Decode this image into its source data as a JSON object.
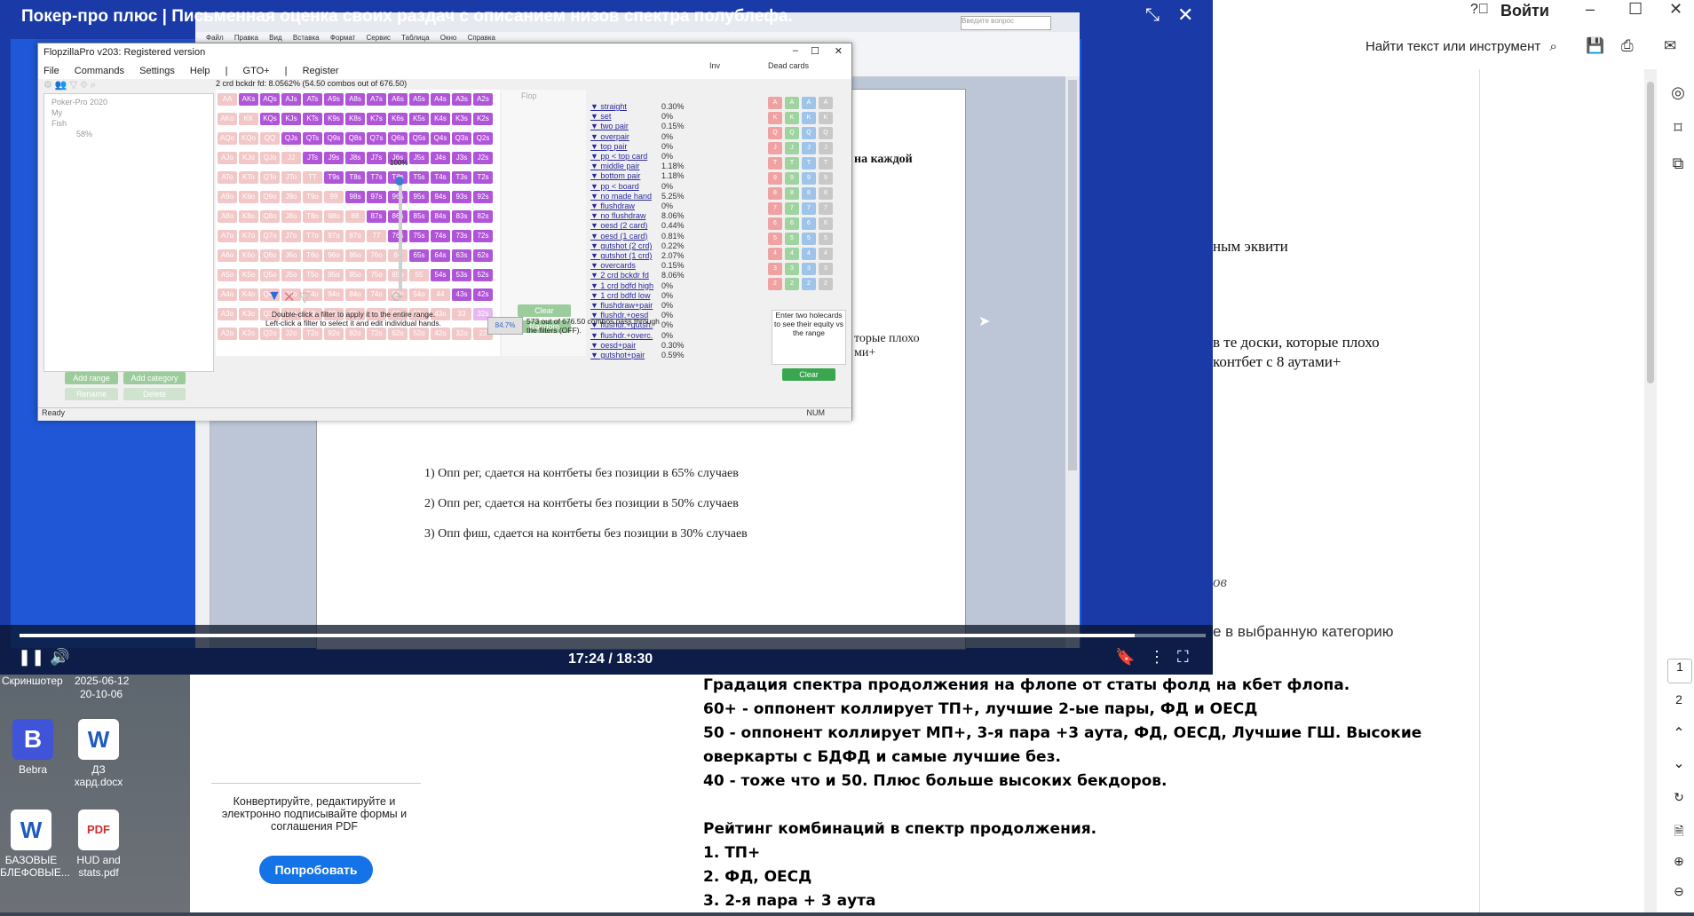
{
  "player": {
    "title": "Покер-про плюс | Письменная оценка своих раздач с описанием низов спектра полублефа.",
    "time": "17:24 / 18:30",
    "progress": 0.94
  },
  "word": {
    "ribbon_hint": "Введите вопрос",
    "menu": [
      "Файл",
      "Правка",
      "Вид",
      "Вставка",
      "Формат",
      "Сервис",
      "Таблица",
      "Окно",
      "Справка"
    ],
    "page_text_partial_1": "на каждой",
    "page_text_partial_2": "торые плохо",
    "page_text_partial_3": "ми+",
    "list": [
      "1)  Опп рег, сдается на контбеты без позиции в 65% случаев",
      "2)  Опп рег, сдается на контбеты без позиции в 50% случаев",
      "3)  Опп фиш, сдается на контбеты без позиции в 30% случаев"
    ]
  },
  "flopzilla": {
    "title": "FlopzillaPro v203: Registered version",
    "menu": [
      "File",
      "Commands",
      "Settings",
      "Help",
      "|",
      "GTO+",
      "|",
      "Register"
    ],
    "header": "2 crd bckdr fd: 8.0562%   (54.50 combos out of 676.50)",
    "tree": [
      "Poker-Pro 2020",
      "My",
      "Fish",
      "58%"
    ],
    "buttons": [
      "Add range",
      "Add category",
      "Rename",
      "Delete"
    ],
    "slider_pct": "100%",
    "filter_hint_1": "Double-click a filter to apply it to the entire range.",
    "filter_hint_2": "Left-click a filter to select it and edit individual hands.",
    "flop_label": "Flop",
    "inv_label": "Inv",
    "dead_cards": "Dead cards",
    "stats": [
      {
        "name": "straight",
        "pct": "0.30%"
      },
      {
        "name": "set",
        "pct": "0%"
      },
      {
        "name": "two pair",
        "pct": "0.15%"
      },
      {
        "name": "overpair",
        "pct": "0%"
      },
      {
        "name": "top pair",
        "pct": "0%"
      },
      {
        "name": "pp < top card",
        "pct": "0%"
      },
      {
        "name": "middle pair",
        "pct": "1.18%"
      },
      {
        "name": "bottom pair",
        "pct": "1.18%"
      },
      {
        "name": "pp < board",
        "pct": "0%"
      },
      {
        "name": "no made hand",
        "pct": "5.25%"
      },
      {
        "name": "flushdraw",
        "pct": "0%"
      },
      {
        "name": "no flushdraw",
        "pct": "8.06%"
      },
      {
        "name": "oesd (2 card)",
        "pct": "0.44%"
      },
      {
        "name": "oesd (1 card)",
        "pct": "0.81%"
      },
      {
        "name": "gutshot (2 crd)",
        "pct": "0.22%"
      },
      {
        "name": "gutshot (1 crd)",
        "pct": "2.07%"
      },
      {
        "name": "overcards",
        "pct": "0.15%"
      },
      {
        "name": "2 crd bckdr fd",
        "pct": "8.06%"
      },
      {
        "name": "1 crd bdfd high",
        "pct": "0%"
      },
      {
        "name": "1 crd bdfd low",
        "pct": "0%"
      },
      {
        "name": "flushdraw+pair",
        "pct": "0%"
      },
      {
        "name": "flushdr.+oesd",
        "pct": "0%"
      },
      {
        "name": "flushdr.+gutsh.",
        "pct": "0%"
      },
      {
        "name": "flushdr.+overc.",
        "pct": "0%"
      },
      {
        "name": "oesd+pair",
        "pct": "0.30%"
      },
      {
        "name": "gutshot+pair",
        "pct": "0.59%"
      }
    ],
    "mid_buttons": [
      "Clear",
      "Random"
    ],
    "filter_result": "573 out of 676.50 combos pass through the filters (OFF).",
    "filter_pct": "84.7%",
    "equity_hint": "Enter two holecards to see their equity vs the range",
    "clear": "Clear",
    "status_left": "Ready",
    "status_right": "NUM",
    "grid_rows": [
      [
        "AA",
        "AKs",
        "AQs",
        "AJs",
        "ATs",
        "A9s",
        "A8s",
        "A7s",
        "A6s",
        "A5s",
        "A4s",
        "A3s",
        "A2s"
      ],
      [
        "AKo",
        "KK",
        "KQs",
        "KJs",
        "KTs",
        "K9s",
        "K8s",
        "K7s",
        "K6s",
        "K5s",
        "K4s",
        "K3s",
        "K2s"
      ],
      [
        "AQo",
        "KQo",
        "QQ",
        "QJs",
        "QTs",
        "Q9s",
        "Q8s",
        "Q7s",
        "Q6s",
        "Q5s",
        "Q4s",
        "Q3s",
        "Q2s"
      ],
      [
        "AJo",
        "KJo",
        "QJo",
        "JJ",
        "JTs",
        "J9s",
        "J8s",
        "J7s",
        "J6s",
        "J5s",
        "J4s",
        "J3s",
        "J2s"
      ],
      [
        "ATo",
        "KTo",
        "QTo",
        "JTo",
        "TT",
        "T9s",
        "T8s",
        "T7s",
        "T6s",
        "T5s",
        "T4s",
        "T3s",
        "T2s"
      ],
      [
        "A9o",
        "K9o",
        "Q9o",
        "J9o",
        "T9o",
        "99",
        "98s",
        "97s",
        "96s",
        "95s",
        "94s",
        "93s",
        "92s"
      ],
      [
        "A8o",
        "K8o",
        "Q8o",
        "J8o",
        "T8o",
        "98o",
        "88",
        "87s",
        "86s",
        "85s",
        "84s",
        "83s",
        "82s"
      ],
      [
        "A7o",
        "K7o",
        "Q7o",
        "J7o",
        "T7o",
        "97o",
        "87o",
        "77",
        "76s",
        "75s",
        "74s",
        "73s",
        "72s"
      ],
      [
        "A6o",
        "K6o",
        "Q6o",
        "J6o",
        "T6o",
        "96o",
        "86o",
        "76o",
        "66",
        "65s",
        "64s",
        "63s",
        "62s"
      ],
      [
        "A5o",
        "K5o",
        "Q5o",
        "J5o",
        "T5o",
        "95o",
        "85o",
        "75o",
        "65o",
        "55",
        "54s",
        "53s",
        "52s"
      ],
      [
        "A4o",
        "K4o",
        "Q4o",
        "J4o",
        "T4o",
        "94o",
        "84o",
        "74o",
        "64o",
        "54o",
        "44",
        "43s",
        "42s"
      ],
      [
        "A3o",
        "K3o",
        "Q3o",
        "J3o",
        "T3o",
        "93o",
        "83o",
        "73o",
        "63o",
        "53o",
        "43o",
        "33",
        "32s"
      ],
      [
        "A2o",
        "K2o",
        "Q2o",
        "J2o",
        "T2o",
        "92o",
        "82o",
        "72o",
        "62o",
        "52o",
        "42o",
        "32o",
        "22"
      ]
    ]
  },
  "acrobat": {
    "login": "Войти",
    "search": "Найти текст или инструмент",
    "partial_1": "ным эквити",
    "partial_2": "в те доски, которые плохо",
    "partial_3": "контбет с 8 аутами+",
    "partial_4": "ов",
    "partial_5": "е в выбранную категорию",
    "lines": [
      {
        "text": "Градация спектра продолжения на флопе от статы фолд на кбет флопа.",
        "color": "#2b2b2b"
      },
      {
        "text": "60+ - оппонент коллирует ТП+, лучшие 2-ые пары, ФД и ОЕСД",
        "color": "#2fa84f"
      },
      {
        "text": "50 - оппонент коллирует МП+, 3-я пара +3 аута, ФД, ОЕСД, Лучшие ГШ. Высокие",
        "color": "#5b2db3"
      },
      {
        "text": "оверкарты с БДФД и самые лучшие без.",
        "color": "#5b2db3"
      },
      {
        "text": "40 - тоже что и 50. Плюс больше высоких бекдоров.",
        "color": "#d4294a"
      },
      {
        "text": "",
        "color": "#000"
      },
      {
        "text": "Рейтинг комбинаций в спектр продолжения.",
        "color": "#2b2b2b"
      },
      {
        "text": "1. ТП+",
        "color": "#2fa84f"
      },
      {
        "text": "2. ФД, ОЕСД",
        "color": "#2fa84f"
      },
      {
        "text": "3. 2-я пара + 3 аута",
        "color": "#2fa84f"
      }
    ],
    "promo_text": "Конвертируйте, редактируйте и электронно подписывайте формы и соглашения PDF",
    "promo_button": "Попробовать",
    "pages": [
      "1",
      "2"
    ]
  },
  "desktop": {
    "screenshot_label": "Скриншотер",
    "screenshot_date": "2025-06-12",
    "screenshot_time": "20-10-06",
    "icons": [
      {
        "label": "Bebra",
        "color": "#3f54d9",
        "glyph": "B"
      },
      {
        "label": "ДЗ хард.docx",
        "color": "#ffffff",
        "glyph": "W"
      },
      {
        "label": "БАЗОВЫЕ БЛЕФОВЫЕ...",
        "color": "#ffffff",
        "glyph": "W"
      },
      {
        "label": "HUD and stats.pdf",
        "color": "#ffffff",
        "glyph": "PDF"
      }
    ]
  }
}
